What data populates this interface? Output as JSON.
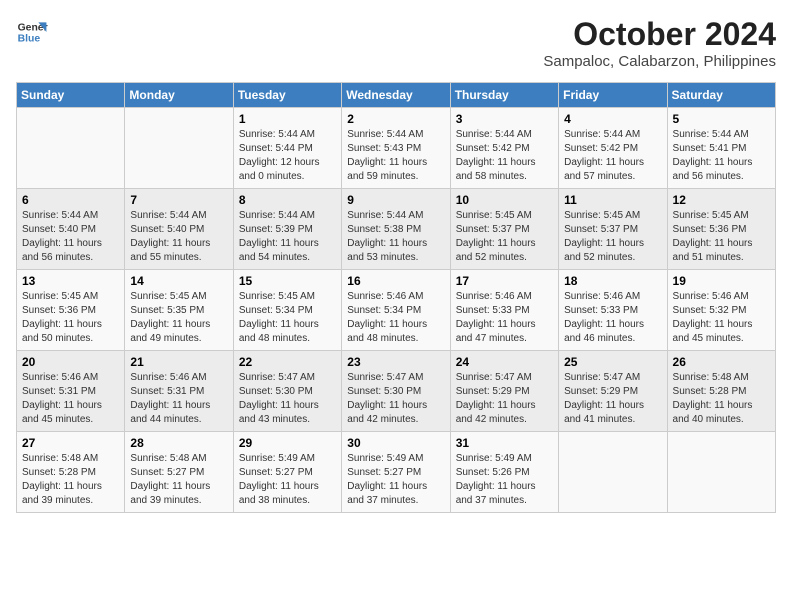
{
  "header": {
    "logo_line1": "General",
    "logo_line2": "Blue",
    "title": "October 2024",
    "subtitle": "Sampaloc, Calabarzon, Philippines"
  },
  "weekdays": [
    "Sunday",
    "Monday",
    "Tuesday",
    "Wednesday",
    "Thursday",
    "Friday",
    "Saturday"
  ],
  "weeks": [
    [
      {
        "day": "",
        "sunrise": "",
        "sunset": "",
        "daylight": ""
      },
      {
        "day": "",
        "sunrise": "",
        "sunset": "",
        "daylight": ""
      },
      {
        "day": "1",
        "sunrise": "Sunrise: 5:44 AM",
        "sunset": "Sunset: 5:44 PM",
        "daylight": "Daylight: 12 hours and 0 minutes."
      },
      {
        "day": "2",
        "sunrise": "Sunrise: 5:44 AM",
        "sunset": "Sunset: 5:43 PM",
        "daylight": "Daylight: 11 hours and 59 minutes."
      },
      {
        "day": "3",
        "sunrise": "Sunrise: 5:44 AM",
        "sunset": "Sunset: 5:42 PM",
        "daylight": "Daylight: 11 hours and 58 minutes."
      },
      {
        "day": "4",
        "sunrise": "Sunrise: 5:44 AM",
        "sunset": "Sunset: 5:42 PM",
        "daylight": "Daylight: 11 hours and 57 minutes."
      },
      {
        "day": "5",
        "sunrise": "Sunrise: 5:44 AM",
        "sunset": "Sunset: 5:41 PM",
        "daylight": "Daylight: 11 hours and 56 minutes."
      }
    ],
    [
      {
        "day": "6",
        "sunrise": "Sunrise: 5:44 AM",
        "sunset": "Sunset: 5:40 PM",
        "daylight": "Daylight: 11 hours and 56 minutes."
      },
      {
        "day": "7",
        "sunrise": "Sunrise: 5:44 AM",
        "sunset": "Sunset: 5:40 PM",
        "daylight": "Daylight: 11 hours and 55 minutes."
      },
      {
        "day": "8",
        "sunrise": "Sunrise: 5:44 AM",
        "sunset": "Sunset: 5:39 PM",
        "daylight": "Daylight: 11 hours and 54 minutes."
      },
      {
        "day": "9",
        "sunrise": "Sunrise: 5:44 AM",
        "sunset": "Sunset: 5:38 PM",
        "daylight": "Daylight: 11 hours and 53 minutes."
      },
      {
        "day": "10",
        "sunrise": "Sunrise: 5:45 AM",
        "sunset": "Sunset: 5:37 PM",
        "daylight": "Daylight: 11 hours and 52 minutes."
      },
      {
        "day": "11",
        "sunrise": "Sunrise: 5:45 AM",
        "sunset": "Sunset: 5:37 PM",
        "daylight": "Daylight: 11 hours and 52 minutes."
      },
      {
        "day": "12",
        "sunrise": "Sunrise: 5:45 AM",
        "sunset": "Sunset: 5:36 PM",
        "daylight": "Daylight: 11 hours and 51 minutes."
      }
    ],
    [
      {
        "day": "13",
        "sunrise": "Sunrise: 5:45 AM",
        "sunset": "Sunset: 5:36 PM",
        "daylight": "Daylight: 11 hours and 50 minutes."
      },
      {
        "day": "14",
        "sunrise": "Sunrise: 5:45 AM",
        "sunset": "Sunset: 5:35 PM",
        "daylight": "Daylight: 11 hours and 49 minutes."
      },
      {
        "day": "15",
        "sunrise": "Sunrise: 5:45 AM",
        "sunset": "Sunset: 5:34 PM",
        "daylight": "Daylight: 11 hours and 48 minutes."
      },
      {
        "day": "16",
        "sunrise": "Sunrise: 5:46 AM",
        "sunset": "Sunset: 5:34 PM",
        "daylight": "Daylight: 11 hours and 48 minutes."
      },
      {
        "day": "17",
        "sunrise": "Sunrise: 5:46 AM",
        "sunset": "Sunset: 5:33 PM",
        "daylight": "Daylight: 11 hours and 47 minutes."
      },
      {
        "day": "18",
        "sunrise": "Sunrise: 5:46 AM",
        "sunset": "Sunset: 5:33 PM",
        "daylight": "Daylight: 11 hours and 46 minutes."
      },
      {
        "day": "19",
        "sunrise": "Sunrise: 5:46 AM",
        "sunset": "Sunset: 5:32 PM",
        "daylight": "Daylight: 11 hours and 45 minutes."
      }
    ],
    [
      {
        "day": "20",
        "sunrise": "Sunrise: 5:46 AM",
        "sunset": "Sunset: 5:31 PM",
        "daylight": "Daylight: 11 hours and 45 minutes."
      },
      {
        "day": "21",
        "sunrise": "Sunrise: 5:46 AM",
        "sunset": "Sunset: 5:31 PM",
        "daylight": "Daylight: 11 hours and 44 minutes."
      },
      {
        "day": "22",
        "sunrise": "Sunrise: 5:47 AM",
        "sunset": "Sunset: 5:30 PM",
        "daylight": "Daylight: 11 hours and 43 minutes."
      },
      {
        "day": "23",
        "sunrise": "Sunrise: 5:47 AM",
        "sunset": "Sunset: 5:30 PM",
        "daylight": "Daylight: 11 hours and 42 minutes."
      },
      {
        "day": "24",
        "sunrise": "Sunrise: 5:47 AM",
        "sunset": "Sunset: 5:29 PM",
        "daylight": "Daylight: 11 hours and 42 minutes."
      },
      {
        "day": "25",
        "sunrise": "Sunrise: 5:47 AM",
        "sunset": "Sunset: 5:29 PM",
        "daylight": "Daylight: 11 hours and 41 minutes."
      },
      {
        "day": "26",
        "sunrise": "Sunrise: 5:48 AM",
        "sunset": "Sunset: 5:28 PM",
        "daylight": "Daylight: 11 hours and 40 minutes."
      }
    ],
    [
      {
        "day": "27",
        "sunrise": "Sunrise: 5:48 AM",
        "sunset": "Sunset: 5:28 PM",
        "daylight": "Daylight: 11 hours and 39 minutes."
      },
      {
        "day": "28",
        "sunrise": "Sunrise: 5:48 AM",
        "sunset": "Sunset: 5:27 PM",
        "daylight": "Daylight: 11 hours and 39 minutes."
      },
      {
        "day": "29",
        "sunrise": "Sunrise: 5:49 AM",
        "sunset": "Sunset: 5:27 PM",
        "daylight": "Daylight: 11 hours and 38 minutes."
      },
      {
        "day": "30",
        "sunrise": "Sunrise: 5:49 AM",
        "sunset": "Sunset: 5:27 PM",
        "daylight": "Daylight: 11 hours and 37 minutes."
      },
      {
        "day": "31",
        "sunrise": "Sunrise: 5:49 AM",
        "sunset": "Sunset: 5:26 PM",
        "daylight": "Daylight: 11 hours and 37 minutes."
      },
      {
        "day": "",
        "sunrise": "",
        "sunset": "",
        "daylight": ""
      },
      {
        "day": "",
        "sunrise": "",
        "sunset": "",
        "daylight": ""
      }
    ]
  ]
}
